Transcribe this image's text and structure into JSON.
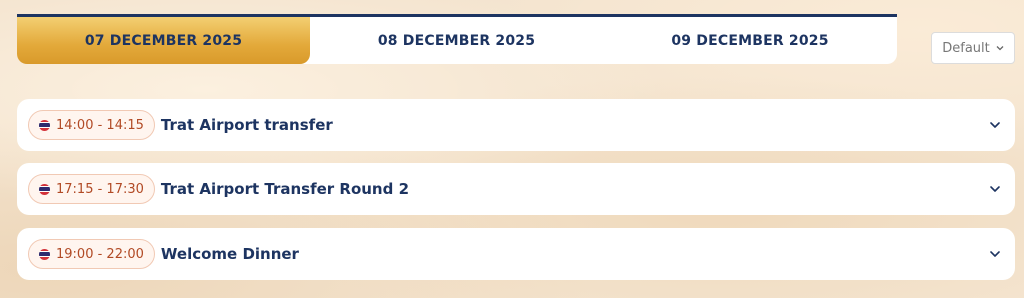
{
  "date_tabs": [
    {
      "label": "07 DECEMBER 2025",
      "active": true
    },
    {
      "label": "08 DECEMBER 2025",
      "active": false
    },
    {
      "label": "09 DECEMBER 2025",
      "active": false
    }
  ],
  "sort": {
    "selected": "Default"
  },
  "events": [
    {
      "time": "14:00 - 14:15",
      "title": "Trat Airport transfer"
    },
    {
      "time": "17:15 - 17:30",
      "title": "Trat Airport Transfer Round 2"
    },
    {
      "time": "19:00 - 22:00",
      "title": "Welcome Dinner"
    }
  ],
  "icons": {
    "flag": "thailand-flag-icon",
    "expand": "chevron-down-icon",
    "select": "chevron-down-icon"
  },
  "colors": {
    "navy": "#1d3461",
    "gold": "#e3a93a",
    "time_text": "#b14a25"
  }
}
